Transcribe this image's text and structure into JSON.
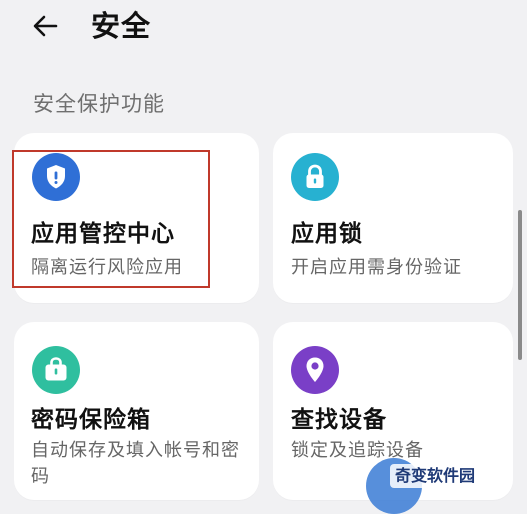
{
  "header": {
    "title": "安全",
    "back_icon": "back-arrow-icon"
  },
  "section": {
    "title": "安全保护功能"
  },
  "cards": [
    {
      "name": "应用管控中心",
      "desc": "隔离运行风险应用",
      "icon": "shield-icon",
      "color": "#2f6fd6"
    },
    {
      "name": "应用锁",
      "desc": "开启应用需身份验证",
      "icon": "lock-icon",
      "color": "#27b1d1"
    },
    {
      "name": "密码保险箱",
      "desc": "自动保存及填入帐号和密码",
      "icon": "safe-box-icon",
      "color": "#2fbf9f"
    },
    {
      "name": "查找设备",
      "desc": "锁定及追踪设备",
      "icon": "location-pin-icon",
      "color": "#7a3fc7"
    }
  ],
  "colors": {
    "background": "#f1f1f3",
    "card_background": "#ffffff",
    "highlight_border": "#c0392b"
  },
  "watermark": {
    "text": "奇变软件园"
  }
}
